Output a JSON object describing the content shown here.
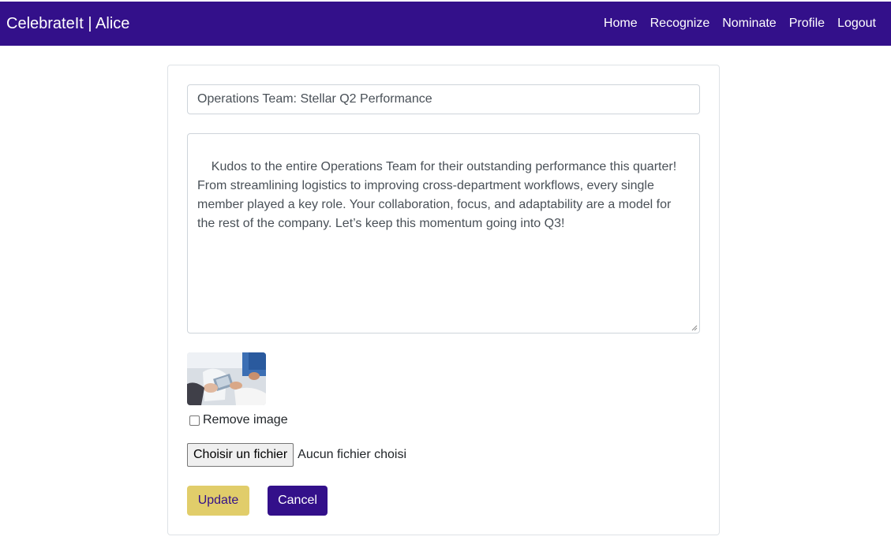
{
  "navbar": {
    "brand": "CelebrateIt | Alice",
    "links": [
      "Home",
      "Recognize",
      "Nominate",
      "Profile",
      "Logout"
    ]
  },
  "form": {
    "title_value": "Operations Team: Stellar Q2 Performance",
    "body_value": "Kudos to the entire Operations Team for their outstanding performance this quarter! From streamlining logistics to improving cross-department workflows, every single member played a key role. Your collaboration, focus, and adaptability are a model for the rest of the company. Let’s keep this momentum going into Q3!",
    "remove_image_label": "Remove image",
    "remove_image_checked": false,
    "file_button_label": "Choisir un fichier",
    "file_status": "Aucun fichier choisi",
    "update_label": "Update",
    "cancel_label": "Cancel"
  },
  "colors": {
    "navbar_bg": "#33108a",
    "update_bg": "#e1cd6a",
    "cancel_bg": "#33108a"
  },
  "icons": {
    "attached_image": "image-thumbnail"
  }
}
